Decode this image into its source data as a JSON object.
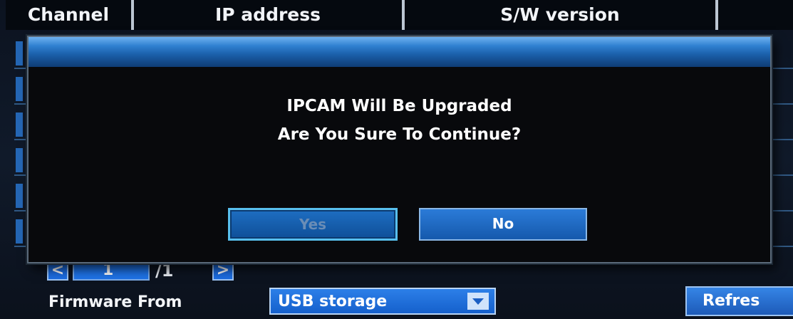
{
  "table": {
    "headers": [
      "Channel",
      "IP address",
      "S/W version",
      ""
    ]
  },
  "pager": {
    "prev_icon": "chevron-left-icon",
    "current_page": "1",
    "total": "/1",
    "next_icon": "chevron-right-icon"
  },
  "firmware": {
    "label": "Firmware From",
    "selected": "USB storage"
  },
  "refresh_label": "Refres",
  "dialog": {
    "title": "",
    "line1": "IPCAM Will Be Upgraded",
    "line2": "Are You Sure To Continue?",
    "yes_label": "Yes",
    "no_label": "No"
  },
  "colors": {
    "accent": "#1e72e6",
    "dialog_bg": "#08090c",
    "title_bar": "#2f7fd0"
  }
}
